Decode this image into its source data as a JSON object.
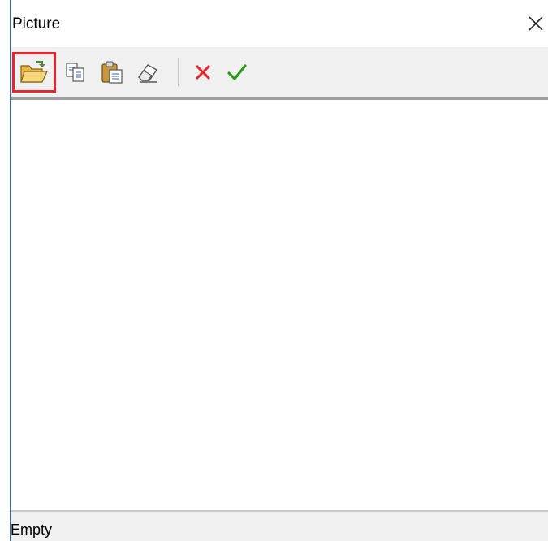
{
  "window": {
    "title": "Picture"
  },
  "toolbar": {
    "buttons": [
      {
        "name": "open",
        "icon": "folder-open-icon",
        "highlighted": true
      },
      {
        "name": "copy",
        "icon": "copy-icon"
      },
      {
        "name": "paste",
        "icon": "paste-icon"
      },
      {
        "name": "clear",
        "icon": "eraser-icon"
      },
      {
        "name": "cancel",
        "icon": "red-x-icon",
        "color": "#e8242c"
      },
      {
        "name": "ok",
        "icon": "green-check-icon",
        "color": "#2e9a1a"
      }
    ],
    "highlight_color": "#e8242c"
  },
  "status": {
    "text": "Empty"
  }
}
